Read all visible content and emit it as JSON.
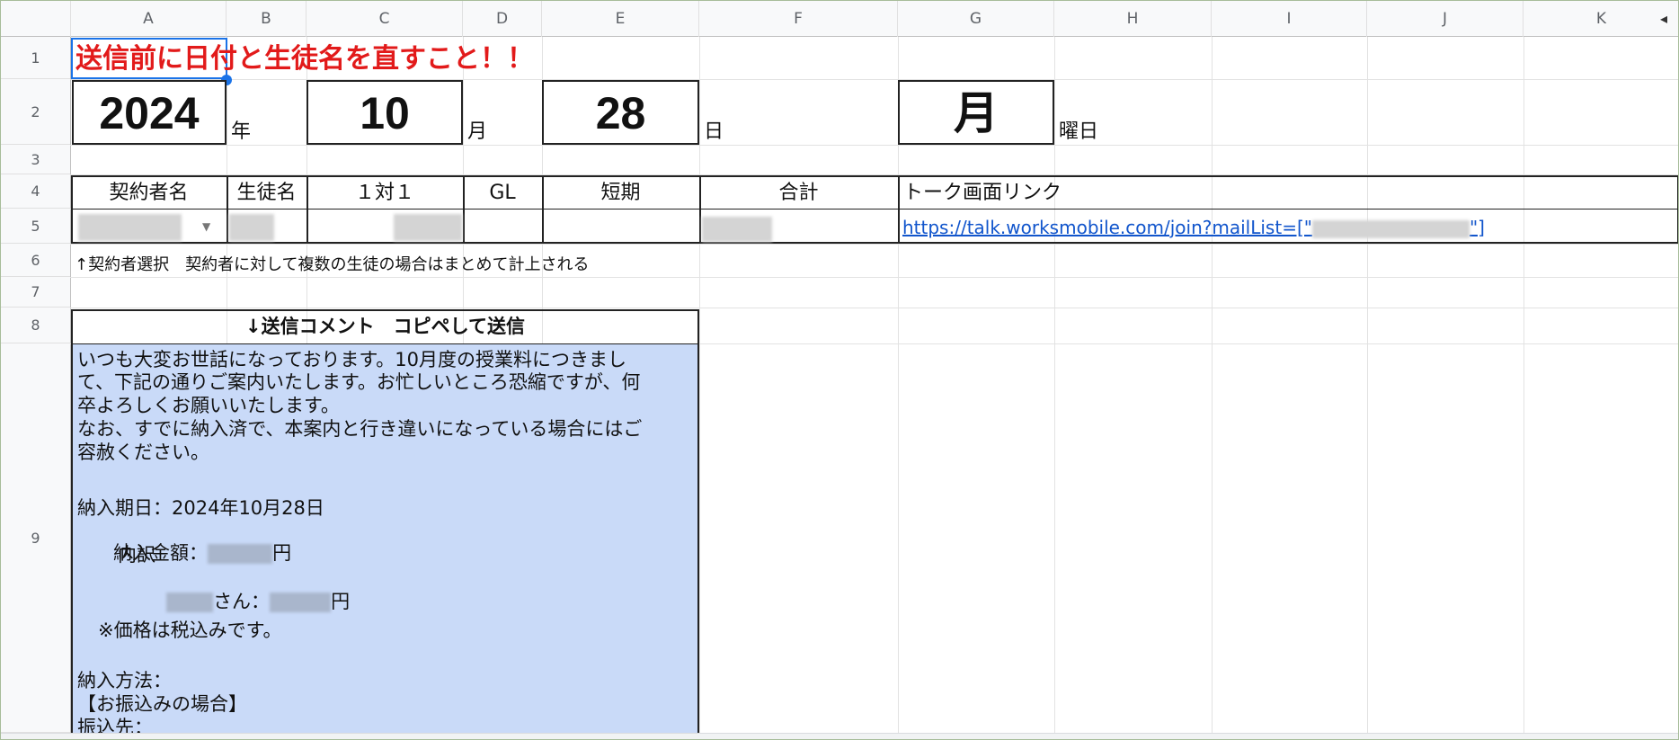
{
  "sheet": {
    "columns": [
      "A",
      "B",
      "C",
      "D",
      "E",
      "F",
      "G",
      "H",
      "I",
      "J",
      "K"
    ],
    "rows": [
      "1",
      "2",
      "3",
      "4",
      "5",
      "6",
      "7",
      "8",
      "9"
    ],
    "scroll_arrow": "◂"
  },
  "a1": {
    "text_part1": "送信前に日",
    "text_part2": "付と生徒名を直すこと！！",
    "color": "#e21a1a"
  },
  "date_row": {
    "year_value": "2024",
    "year_unit": "年",
    "month_value": "10",
    "month_unit": "月",
    "day_value": "28",
    "day_unit": "日",
    "weekday_value": "月",
    "weekday_unit": "曜日"
  },
  "table": {
    "headers": [
      "契約者名",
      "生徒名",
      "１対１",
      "GL",
      "短期",
      "合計",
      "トーク画面リンク"
    ],
    "link_prefix": "https://talk.worksmobile.com/join?mailList=[\"",
    "link_suffix": "\"]",
    "dropdown_icon": "▼"
  },
  "note_row6": "↑契約者選択　契約者に対して複数の生徒の場合はまとめて計上される",
  "comment_header": "↓送信コメント　コピペして送信",
  "comment": {
    "line1": "いつも大変お世話になっております。10月度の授業料につきまし",
    "line2": "て、下記の通りご案内いたします。お忙しいところ恐縮ですが、何",
    "line3": "卒よろしくお願いいたします。",
    "line4": "なお、すでに納入済で、本案内と行き違いになっている場合にはご",
    "line5": "容赦ください。",
    "line6": "納入期日：2024年10月28日",
    "line7_prefix": "納入金額：",
    "line7_suffix": "円",
    "line8": "内訳",
    "line9_mid": "さん：",
    "line9_suffix": "円",
    "line10": "※価格は税込みです。",
    "line11": "納入方法：",
    "line12": "【お振込みの場合】",
    "line13": "振込先："
  },
  "colors": {
    "comment_bg": "#c9daf8",
    "selection": "#1a73e8",
    "link": "#1155cc"
  }
}
